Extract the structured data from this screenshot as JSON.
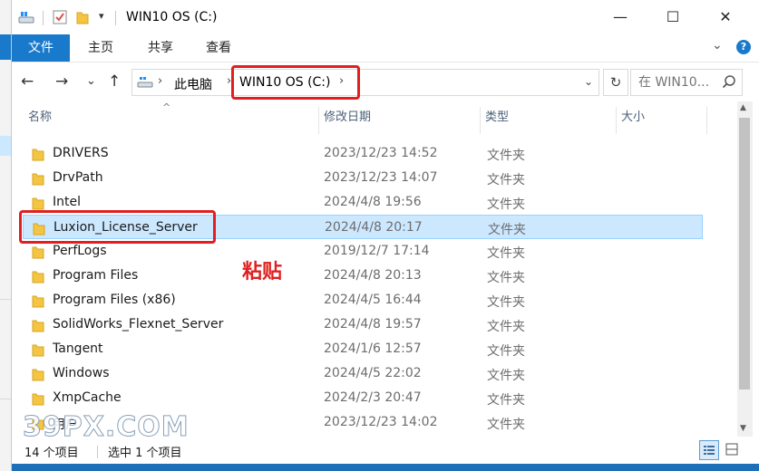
{
  "window": {
    "title": "WIN10 OS (C:)",
    "controls": {
      "minimize": "—",
      "maximize": "☐",
      "close": "✕"
    }
  },
  "ribbon": {
    "tabs": [
      "文件",
      "主页",
      "共享",
      "查看"
    ],
    "expand_glyph": "⌄",
    "help_glyph": "?"
  },
  "nav": {
    "back": "←",
    "forward": "→",
    "recent": "⌄",
    "up": "↑",
    "breadcrumb": [
      "此电脑",
      "WIN10 OS (C:)"
    ],
    "search_placeholder": "在 WIN10..."
  },
  "columns": [
    "名称",
    "修改日期",
    "类型",
    "大小"
  ],
  "rows": [
    {
      "name": "DRIVERS",
      "date": "2023/12/23 14:52",
      "type": "文件夹"
    },
    {
      "name": "DrvPath",
      "date": "2023/12/23 14:07",
      "type": "文件夹"
    },
    {
      "name": "Intel",
      "date": "2024/4/8 19:56",
      "type": "文件夹"
    },
    {
      "name": "Luxion_License_Server",
      "date": "2024/4/8 20:17",
      "type": "文件夹",
      "selected": true
    },
    {
      "name": "PerfLogs",
      "date": "2019/12/7 17:14",
      "type": "文件夹"
    },
    {
      "name": "Program Files",
      "date": "2024/4/8 20:13",
      "type": "文件夹"
    },
    {
      "name": "Program Files (x86)",
      "date": "2024/4/5 16:44",
      "type": "文件夹"
    },
    {
      "name": "SolidWorks_Flexnet_Server",
      "date": "2024/4/8 19:57",
      "type": "文件夹"
    },
    {
      "name": "Tangent",
      "date": "2024/1/6 12:57",
      "type": "文件夹"
    },
    {
      "name": "Windows",
      "date": "2024/4/5 22:02",
      "type": "文件夹"
    },
    {
      "name": "XmpCache",
      "date": "2024/2/3 20:47",
      "type": "文件夹"
    },
    {
      "name": "用户",
      "date": "2023/12/23 14:02",
      "type": "文件夹"
    }
  ],
  "annotation": "粘贴",
  "status": {
    "count": "14 个项目",
    "selected": "选中 1 个项目"
  },
  "watermark": "39PX.COM",
  "colors": {
    "accent": "#1979ca",
    "highlight": "#e02020",
    "selection": "#cce8ff",
    "folder": "#f4c542"
  },
  "icons": [
    "drive-icon",
    "check-icon",
    "folder-icon",
    "search-icon",
    "refresh-icon",
    "details-view-icon",
    "tiles-view-icon"
  ]
}
